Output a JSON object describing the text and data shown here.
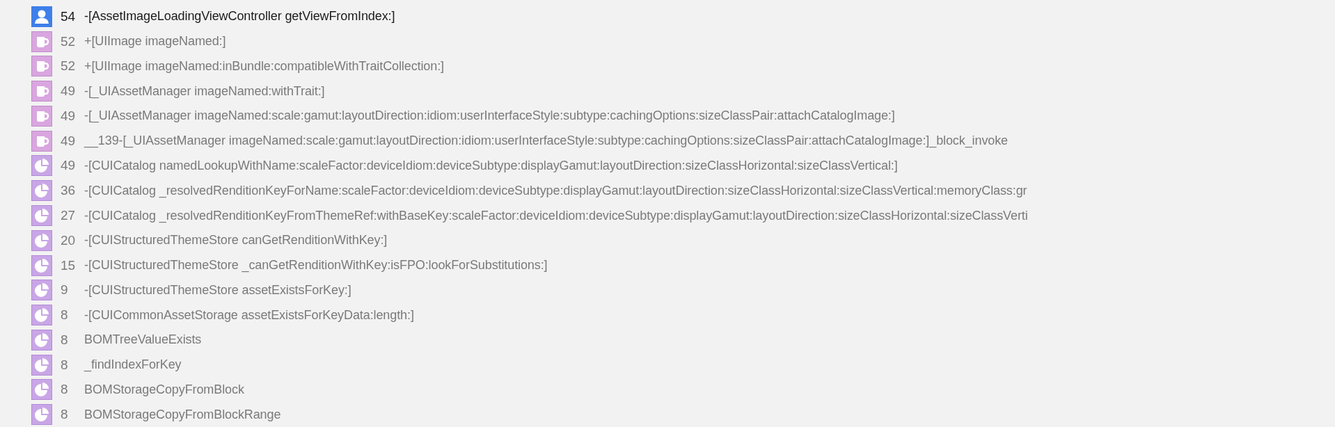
{
  "rows": [
    {
      "kind": "user",
      "count": "54",
      "symbol": "-[AssetImageLoadingViewController getViewFromIndex:]"
    },
    {
      "kind": "library",
      "count": "52",
      "symbol": "+[UIImage imageNamed:]"
    },
    {
      "kind": "library",
      "count": "52",
      "symbol": "+[UIImage imageNamed:inBundle:compatibleWithTraitCollection:]"
    },
    {
      "kind": "library",
      "count": "49",
      "symbol": "-[_UIAssetManager imageNamed:withTrait:]"
    },
    {
      "kind": "library",
      "count": "49",
      "symbol": "-[_UIAssetManager imageNamed:scale:gamut:layoutDirection:idiom:userInterfaceStyle:subtype:cachingOptions:sizeClassPair:attachCatalogImage:]"
    },
    {
      "kind": "library",
      "count": "49",
      "symbol": "__139-[_UIAssetManager imageNamed:scale:gamut:layoutDirection:idiom:userInterfaceStyle:subtype:cachingOptions:sizeClassPair:attachCatalogImage:]_block_invoke"
    },
    {
      "kind": "framework",
      "count": "49",
      "symbol": "-[CUICatalog namedLookupWithName:scaleFactor:deviceIdiom:deviceSubtype:displayGamut:layoutDirection:sizeClassHorizontal:sizeClassVertical:]"
    },
    {
      "kind": "framework",
      "count": "36",
      "symbol": "-[CUICatalog _resolvedRenditionKeyForName:scaleFactor:deviceIdiom:deviceSubtype:displayGamut:layoutDirection:sizeClassHorizontal:sizeClassVertical:memoryClass:gr"
    },
    {
      "kind": "framework",
      "count": "27",
      "symbol": "-[CUICatalog _resolvedRenditionKeyFromThemeRef:withBaseKey:scaleFactor:deviceIdiom:deviceSubtype:displayGamut:layoutDirection:sizeClassHorizontal:sizeClassVerti"
    },
    {
      "kind": "framework",
      "count": "20",
      "symbol": "-[CUIStructuredThemeStore canGetRenditionWithKey:]"
    },
    {
      "kind": "framework",
      "count": "15",
      "symbol": "-[CUIStructuredThemeStore _canGetRenditionWithKey:isFPO:lookForSubstitutions:]"
    },
    {
      "kind": "framework",
      "count": "9",
      "symbol": "-[CUIStructuredThemeStore assetExistsForKey:]"
    },
    {
      "kind": "framework",
      "count": "8",
      "symbol": "-[CUICommonAssetStorage assetExistsForKeyData:length:]"
    },
    {
      "kind": "framework",
      "count": "8",
      "symbol": "BOMTreeValueExists"
    },
    {
      "kind": "framework",
      "count": "8",
      "symbol": "_findIndexForKey"
    },
    {
      "kind": "framework",
      "count": "8",
      "symbol": "BOMStorageCopyFromBlock"
    },
    {
      "kind": "framework",
      "count": "8",
      "symbol": "BOMStorageCopyFromBlockRange"
    }
  ]
}
